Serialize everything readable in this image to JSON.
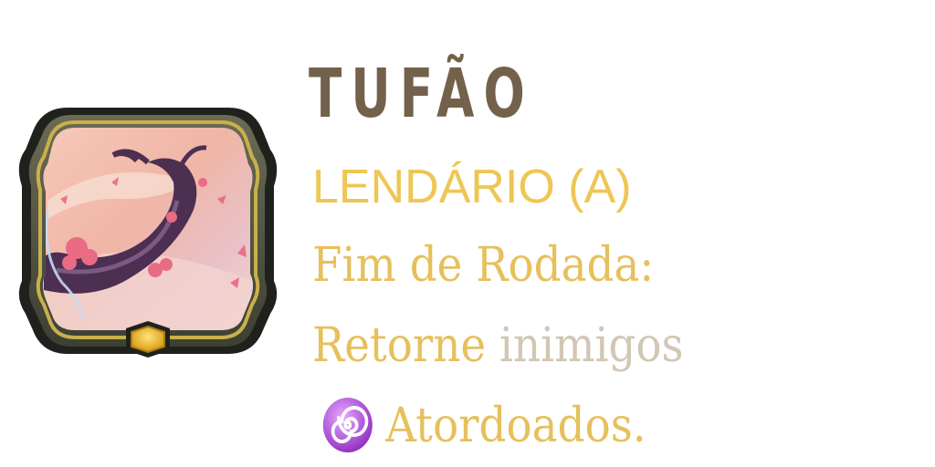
{
  "card": {
    "title": "TUFÃO",
    "rarity": "LENDÁRIO (A)",
    "description": {
      "line1": "Fim de Rodada:",
      "line2_part1": "Retorne",
      "line2_part2": "inimigos",
      "line3_icon": "stun-spiral-icon",
      "line3_text": "Atordoados."
    },
    "artwork_icon": "typhoon-tree-artwork-icon"
  },
  "colors": {
    "title": "#74614b",
    "rarity": "#eec654",
    "keyword": "#e7c05c",
    "muted": "#d2c6b4",
    "frame_dark": "#2b2f26",
    "frame_trim": "#c9b04a",
    "gem": "#f2c438",
    "spiral": "#a23ad0"
  }
}
